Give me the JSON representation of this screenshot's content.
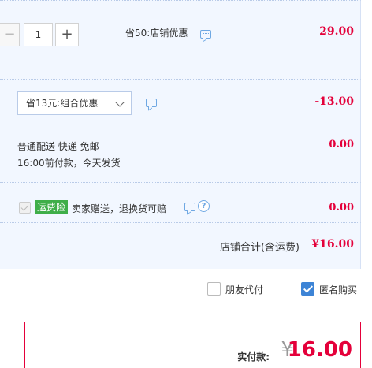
{
  "item": {
    "quantity": "1",
    "minus_symbol": "−",
    "plus_symbol": "+",
    "promo_text": "省50:店铺优惠",
    "amount": "29.00"
  },
  "combo": {
    "select_value": "省13元:组合优惠",
    "amount": "-13.00"
  },
  "shipping": {
    "line1": "普通配送 快递 免邮",
    "line2": "16:00前付款，今天发货",
    "amount": "0.00"
  },
  "insurance": {
    "badge": "运费险",
    "text": "卖家赠送，退换货可赔",
    "help_symbol": "?",
    "amount": "0.00"
  },
  "subtotal": {
    "label": "店铺合计(含运费)",
    "amount": "¥16.00"
  },
  "options": {
    "friend_pay_label": "朋友代付",
    "friend_pay_checked": false,
    "anonymous_label": "匿名购买",
    "anonymous_checked": true
  },
  "payment": {
    "label": "实付款:",
    "currency": "¥",
    "amount": "16.00"
  },
  "colors": {
    "accent_red": "#e4003a",
    "panel_bg": "#f2f7ff",
    "insurance_green": "#3fae49",
    "checkbox_blue": "#3d84d6"
  }
}
